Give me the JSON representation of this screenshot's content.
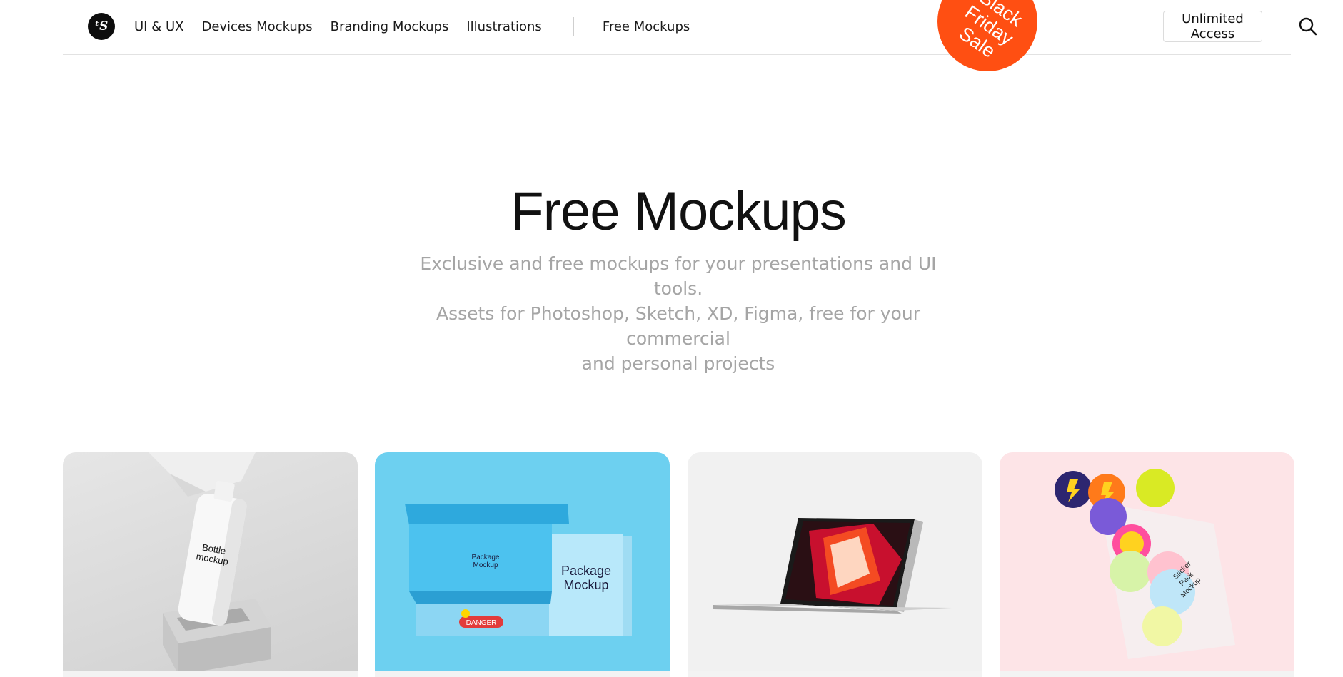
{
  "header": {
    "logo_text": "ᵗS",
    "nav": [
      "UI & UX",
      "Devices Mockups",
      "Branding Mockups",
      "Illustrations",
      "Free Mockups"
    ],
    "badge_lines": [
      "Black",
      "Friday",
      "Sale"
    ],
    "badge_color": "#ff4f12",
    "access_label": "Unlimited Access",
    "search_icon": "search-icon"
  },
  "hero": {
    "title": "Free Mockups",
    "subtitle_lines": [
      "Exclusive and free mockups for your presentations and UI tools.",
      "Assets for Photoshop, Sketch, XD, Figma, free for your commercial",
      "and personal projects"
    ]
  },
  "cards": [
    {
      "name": "bottle-mockup",
      "caption_lines": [
        "Bottle",
        "mockup"
      ]
    },
    {
      "name": "package-mockup",
      "caption_lines": [
        "Package",
        "Mockup"
      ],
      "sticker": "DANGER"
    },
    {
      "name": "macbook-mockup"
    },
    {
      "name": "sticker-pack-mockup",
      "caption_lines": [
        "Sticker",
        "Pack",
        "Mockup"
      ]
    }
  ]
}
